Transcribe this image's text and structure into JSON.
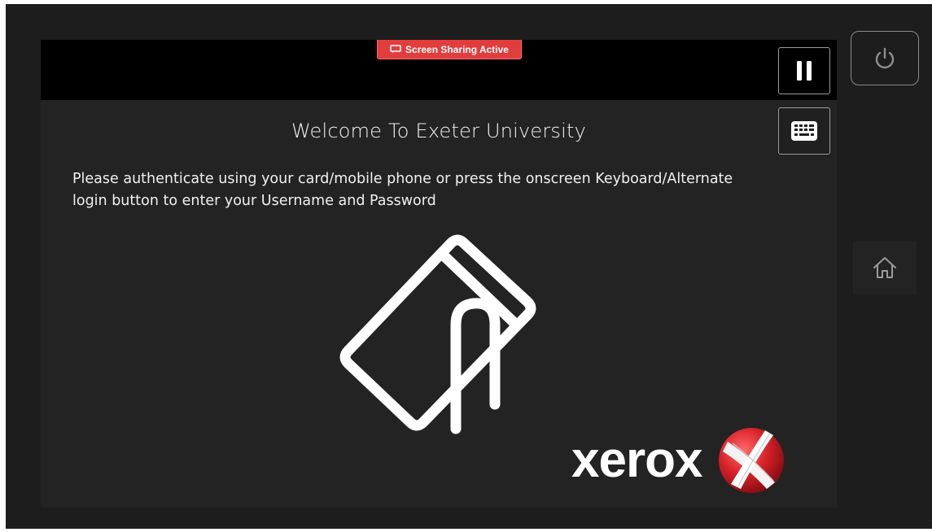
{
  "status": {
    "badge_text": "Screen Sharing Active",
    "badge_icon": "screen-share-icon",
    "badge_color": "#e23d3d"
  },
  "controls": {
    "pause_icon": "pause-icon",
    "keyboard_icon": "keyboard-icon",
    "power_icon": "power-icon",
    "home_icon": "home-icon"
  },
  "content": {
    "title": "Welcome To Exeter University",
    "instructions_line1": "Please authenticate using your card/mobile phone or press the onscreen Keyboard/Alternate",
    "instructions_line2": "login button to enter your Username and Password",
    "graphic": "card-tap-icon"
  },
  "brand": {
    "name": "xerox",
    "accent": "#d9232a"
  }
}
